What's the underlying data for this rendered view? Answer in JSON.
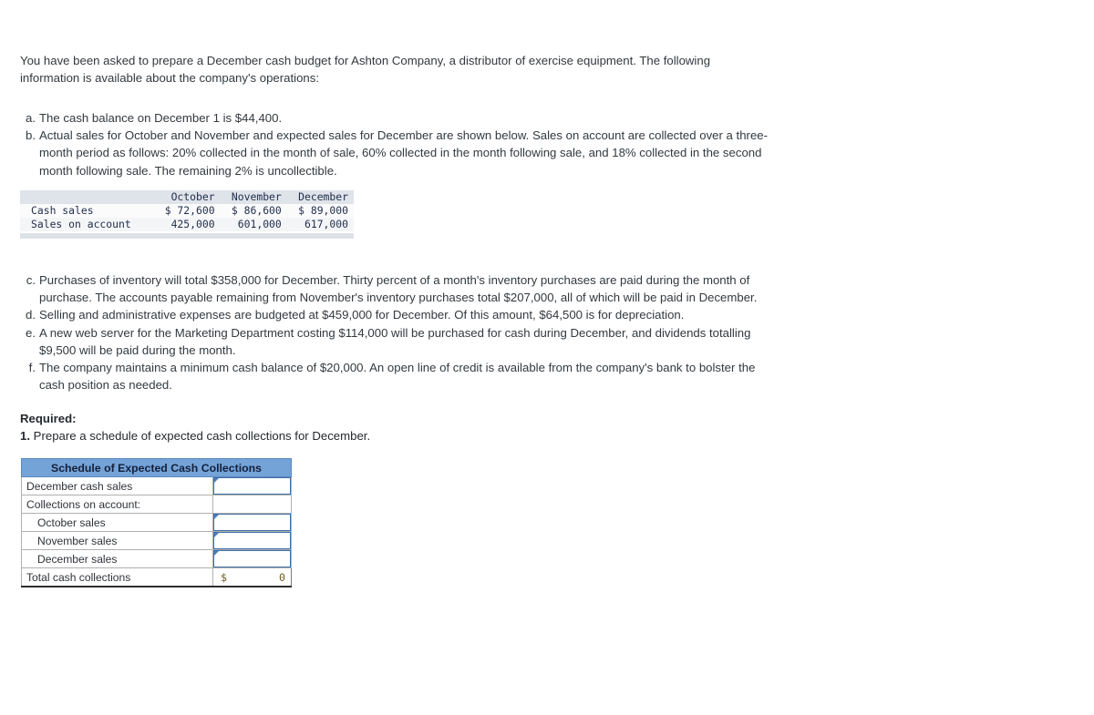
{
  "intro": {
    "text": "You have been asked to prepare a December cash budget for Ashton Company, a distributor of exercise equipment. The following information is available about the company's operations:"
  },
  "facts": [
    {
      "marker": "a.",
      "text": "The cash balance on December 1 is $44,400."
    },
    {
      "marker": "b.",
      "text": "Actual sales for October and November and expected sales for December are shown below. Sales on account are collected over a three-month period as follows: 20% collected in the month of sale, 60% collected in the month following sale, and 18% collected in the second month following sale. The remaining 2% is uncollectible."
    },
    {
      "marker": "c.",
      "text": "Purchases of inventory will total $358,000 for December. Thirty percent of a month's inventory purchases are paid during the month of purchase. The accounts payable remaining from November's inventory purchases total $207,000, all of which will be paid in December."
    },
    {
      "marker": "d.",
      "text": "Selling and administrative expenses are budgeted at $459,000 for December. Of this amount, $64,500 is for depreciation."
    },
    {
      "marker": "e.",
      "text": "A new web server for the Marketing Department costing $114,000 will be purchased for cash during December, and dividends totalling $9,500 will be paid during the month."
    },
    {
      "marker": "f.",
      "text": "The company maintains a minimum cash balance of $20,000. An open line of credit is available from the company's bank to bolster the cash position as needed."
    }
  ],
  "sales_table": {
    "columns": [
      "",
      "October",
      "November",
      "December"
    ],
    "rows": [
      {
        "label": "Cash sales",
        "values": [
          "$ 72,600",
          "$ 86,600",
          "$ 89,000"
        ]
      },
      {
        "label": "Sales on account",
        "values": [
          "425,000",
          "601,000",
          "617,000"
        ]
      }
    ]
  },
  "required": {
    "title": "Required:",
    "item_number": "1.",
    "item_text": "Prepare a schedule of expected cash collections for December."
  },
  "schedule": {
    "title": "Schedule of Expected Cash Collections",
    "rows": [
      {
        "label": "December cash sales",
        "indent": false,
        "cell": "input",
        "value": ""
      },
      {
        "label": "Collections on account:",
        "indent": false,
        "cell": "blank",
        "value": ""
      },
      {
        "label": "October sales",
        "indent": true,
        "cell": "input",
        "value": ""
      },
      {
        "label": "November sales",
        "indent": true,
        "cell": "input",
        "value": ""
      },
      {
        "label": "December sales",
        "indent": true,
        "cell": "input",
        "value": ""
      }
    ],
    "total": {
      "label": "Total cash collections",
      "currency": "$",
      "value": "0"
    }
  },
  "colors": {
    "schedule_header_bg": "#74a3d8",
    "input_border": "#3f6fa8",
    "sales_header_bg": "#dfe3ea",
    "total_text": "#6b5a1e"
  }
}
